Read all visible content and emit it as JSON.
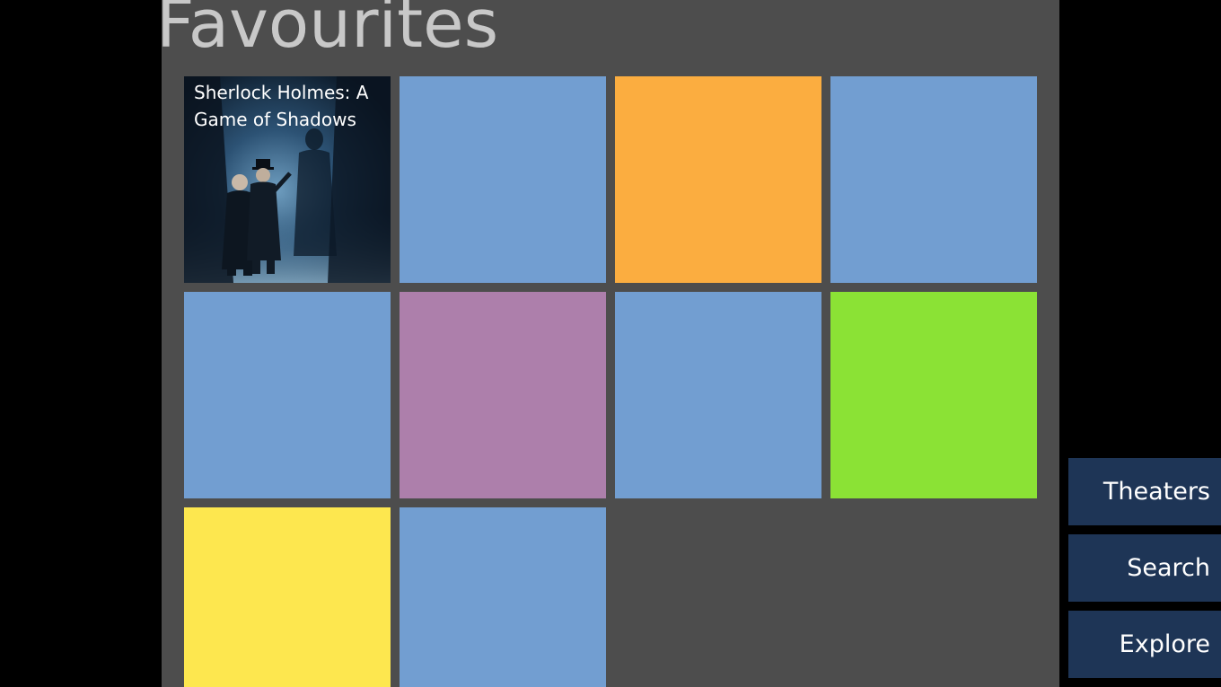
{
  "page": {
    "title": "Favourites"
  },
  "tiles": [
    {
      "label": "Sherlock Holmes: A Game of Shadows",
      "color": "#0f2235",
      "has_poster": true
    },
    {
      "label": "",
      "color": "#729ed1"
    },
    {
      "label": "",
      "color": "#fbad40"
    },
    {
      "label": "",
      "color": "#729ed1"
    },
    {
      "label": "",
      "color": "#729ed1"
    },
    {
      "label": "",
      "color": "#ad7fab"
    },
    {
      "label": "",
      "color": "#729ed1"
    },
    {
      "label": "",
      "color": "#8be235"
    },
    {
      "label": "",
      "color": "#fde74f"
    },
    {
      "label": "",
      "color": "#729ed1"
    }
  ],
  "nav": {
    "theaters": "Theaters",
    "search": "Search",
    "explore": "Explore"
  },
  "colors": {
    "background": "#000000",
    "panel": "#4d4d4d",
    "title_text": "#c8c8c8",
    "nav_button": "#1e3556"
  }
}
